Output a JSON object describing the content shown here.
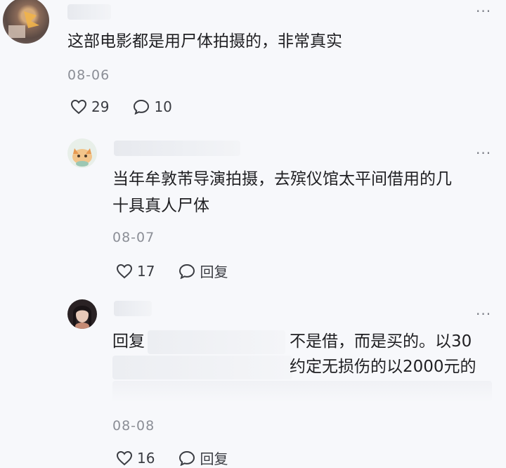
{
  "comments": [
    {
      "text": "这部电影都是用尸体拍摄的，非常真实",
      "date": "08-06",
      "likes": "29",
      "replies": "10"
    },
    {
      "text_line1": "当年牟敦芾导演拍摄，去殡仪馆太平间借用的几",
      "text_line2": "十具真人尸体",
      "date": "08-07",
      "likes": "17",
      "reply_label": "回复"
    },
    {
      "reply_prefix": "回复",
      "text_line1": "不是借，而是买的。以30",
      "text_line2": "约定无损伤的以2000元的",
      "date": "08-08",
      "likes": "16",
      "reply_label": "回复"
    }
  ],
  "more_label": "···",
  "icons": {
    "like": "heart-outline-icon",
    "comment": "speech-bubble-icon",
    "more": "more-dots-icon"
  }
}
